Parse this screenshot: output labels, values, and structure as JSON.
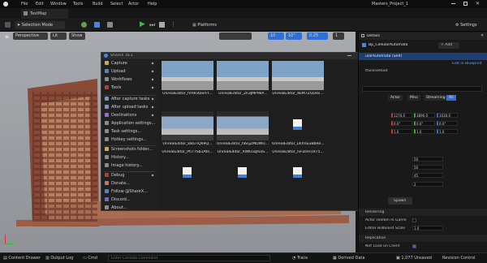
{
  "titlebar": {
    "menus": [
      "File",
      "Edit",
      "Window",
      "Tools",
      "Build",
      "Select",
      "Actor",
      "Help"
    ],
    "project": "Masters_Project_1"
  },
  "tab": {
    "label": "TestMap"
  },
  "toolbar": {
    "selection_mode": "Selection Mode",
    "platforms": "Platforms",
    "settings": "Settings"
  },
  "viewport": {
    "perspective": "Perspective",
    "lit": "Lit",
    "show": "Show",
    "grid_snap": "10",
    "rot_snap": "10°",
    "scale_snap": "0.25",
    "cam_speed": "1"
  },
  "sharex": {
    "title": "ShareX 16.1",
    "menu": [
      {
        "label": "Capture",
        "arrow": true,
        "color": "#d4a94a"
      },
      {
        "label": "Upload",
        "arrow": true,
        "color": "#4a86d4"
      },
      {
        "label": "Workflows",
        "arrow": true,
        "color": "#8a8a8a"
      },
      {
        "label": "Tools",
        "arrow": true,
        "color": "#c0392b"
      },
      {
        "label": "After capture tasks",
        "arrow": true,
        "color": "#6a9ad4"
      },
      {
        "label": "After upload tasks",
        "arrow": true,
        "color": "#6a9ad4"
      },
      {
        "label": "Destinations",
        "arrow": true,
        "color": "#9a6ad4"
      },
      {
        "label": "Application settings...",
        "arrow": false,
        "color": "#8a8a8a"
      },
      {
        "label": "Task settings...",
        "arrow": false,
        "color": "#8a8a8a"
      },
      {
        "label": "Hotkey settings...",
        "arrow": false,
        "color": "#8a8a8a"
      },
      {
        "label": "Screenshots folder...",
        "arrow": false,
        "color": "#d4a94a"
      },
      {
        "label": "History...",
        "arrow": false,
        "color": "#8a8a8a"
      },
      {
        "label": "Image history...",
        "arrow": false,
        "color": "#8a8a8a"
      },
      {
        "label": "Debug",
        "arrow": true,
        "color": "#c0392b"
      },
      {
        "label": "Donate...",
        "arrow": false,
        "color": "#d46a6a"
      },
      {
        "label": "Follow @ShareX...",
        "arrow": false,
        "color": "#4a86d4"
      },
      {
        "label": "Discord...",
        "arrow": false,
        "color": "#6a6ad4"
      },
      {
        "label": "About...",
        "arrow": false,
        "color": "#8a8a8a"
      }
    ],
    "items": [
      {
        "caption": "UnrealEditor_fm9n4zerFt...",
        "kind": "sky"
      },
      {
        "caption": "UnrealEditor_2h3JMP9kP...",
        "kind": "sky"
      },
      {
        "caption": "UnrealEditor_6kM7ZOD4s...",
        "kind": "sky"
      },
      {
        "caption": "UnrealEditor_k8a7iQ69Q...",
        "kind": "dark"
      },
      {
        "caption": "UnrealEditor_hbnjZMOWU...",
        "kind": "dark"
      },
      {
        "caption": "UnrealEditor_LKXnEuBbRe...",
        "kind": "file"
      },
      {
        "caption": "UnrealEditor_Ph77Sb1Atn...",
        "kind": "file"
      },
      {
        "caption": "UnrealEditor_XWKsiqmaS...",
        "kind": "file"
      },
      {
        "caption": "UnrealEditor_IvFDnH1975...",
        "kind": "file"
      }
    ]
  },
  "details": {
    "tab": "Details",
    "actor_name": "Bp_CellularAutomata",
    "add_label": "+ Add",
    "self_label": "ularAutomata (Self)",
    "edit_bp": "Edit in Blueprint",
    "root": "ltSceneRoot",
    "filter_tabs": [
      "Actor",
      "Misc",
      "Streaming",
      "All"
    ],
    "loc": [
      "1270.0",
      "3890.0",
      "1030.0"
    ],
    "rot": [
      "0.0°",
      "0.0°",
      "0.0°"
    ],
    "scale": [
      "1.0",
      "1.0",
      "1.0"
    ],
    "fields": [
      "50",
      "50",
      "45",
      "2"
    ],
    "spawn_label": "Spawn",
    "rendering": "Rendering",
    "hidden_in_game": "Actor Hidden In Game",
    "billboard": "Editor Billboard Scale",
    "billboard_val": "1.0",
    "replication": "Replication",
    "net_load": "Net Load on Client"
  },
  "statusbar": {
    "content_drawer": "Content Drawer",
    "output_log": "Output Log",
    "cmd": "Cmd",
    "console_placeholder": "Enter Console Command",
    "trace": "Trace",
    "derived_data": "Derived Data",
    "unsaved": "1,077 Unsaved",
    "revision": "Revision Control"
  },
  "colors": {
    "accent": "#2f6fd6",
    "brick": "#8a4a38",
    "sky": "#7fa3c6"
  }
}
